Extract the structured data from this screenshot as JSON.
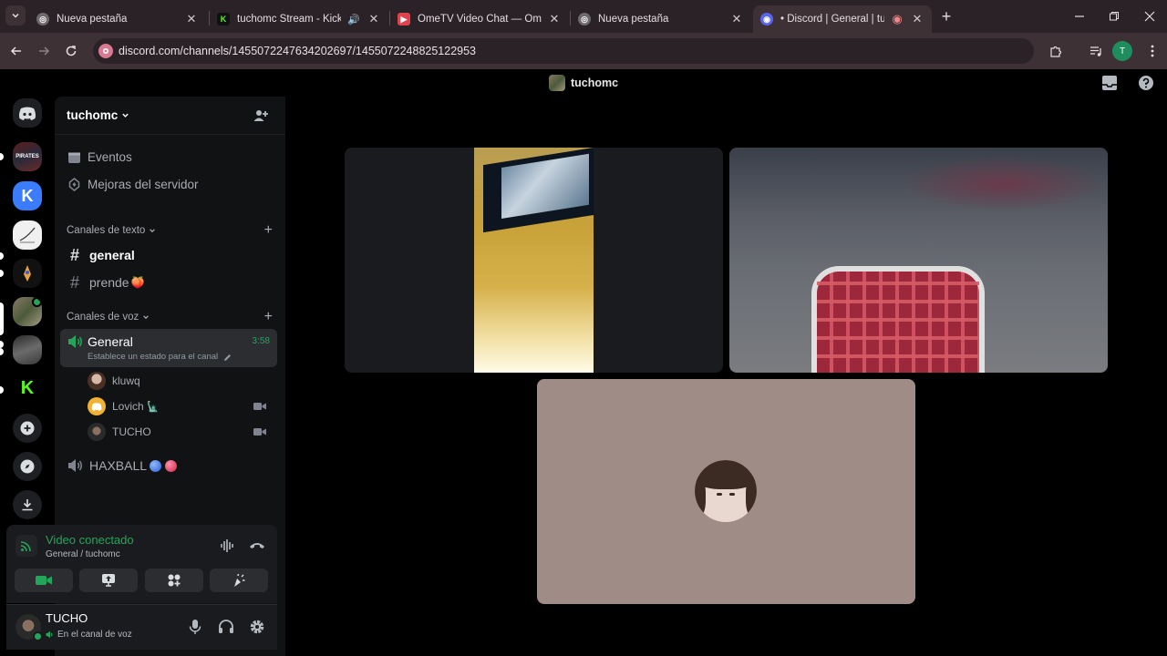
{
  "browser": {
    "tabs": [
      {
        "title": "Nueva pestaña",
        "icon": "chrome-icon"
      },
      {
        "title": "tuchomc Stream - Kick Dash",
        "icon": "kick-icon"
      },
      {
        "title": "OmeTV Video Chat — Omegle",
        "icon": "ometv-icon"
      },
      {
        "title": "Nueva pestaña",
        "icon": "chrome-icon"
      },
      {
        "title": "• Discord | General | tuchomc",
        "icon": "discord-icon"
      }
    ],
    "new_tab": "+",
    "url": "discord.com/channels/1455072247634202697/1455072248825122953",
    "profile_initial": "T"
  },
  "discord": {
    "topbar_title": "tuchomc",
    "server_name": "tuchomc",
    "menu": {
      "events": "Eventos",
      "boosts": "Mejoras del servidor"
    },
    "text_category": "Canales de texto",
    "text_channels": [
      {
        "name": "general",
        "emoji": ""
      },
      {
        "name": "prende",
        "emoji": "🍑"
      }
    ],
    "voice_category": "Canales de voz",
    "voice_channel": {
      "name": "General",
      "timer": "3:58",
      "status_hint": "Establece un estado para el canal"
    },
    "voice_users": [
      {
        "name": "kluwq",
        "emoji": ""
      },
      {
        "name": "Lovich",
        "emoji": "🗽"
      },
      {
        "name": "TUCHO",
        "emoji": ""
      }
    ],
    "haxball_channel": {
      "name": "HAXBALL"
    },
    "rtc": {
      "status": "Video conectado",
      "location": "General / tuchomc"
    },
    "user": {
      "name": "TUCHO",
      "status": "En el canal de voz"
    }
  },
  "colors": {
    "green": "#23a55a",
    "blurple": "#5865f2",
    "tile_bg": "#a08c86",
    "kick_green": "#53fc18"
  }
}
